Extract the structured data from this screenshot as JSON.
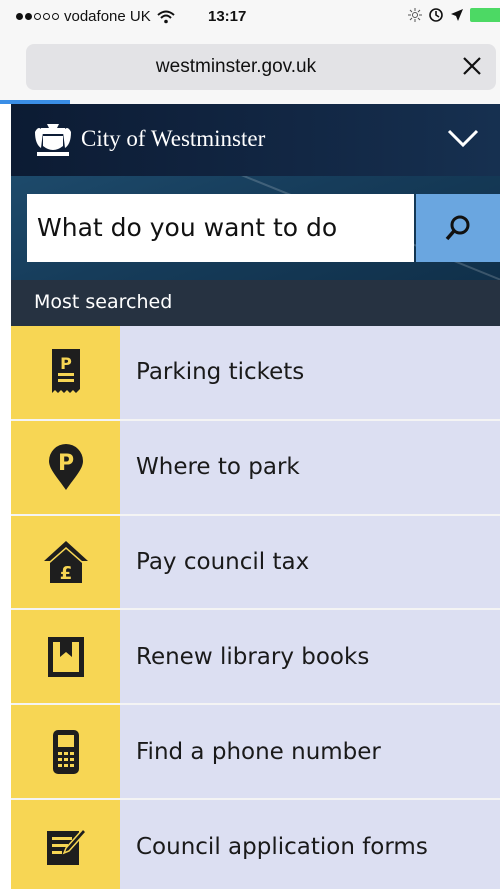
{
  "status_bar": {
    "carrier": "vodafone UK",
    "time": "13:17",
    "signal_bars_filled": 2,
    "signal_bars_total": 5,
    "icons": [
      "wifi-icon",
      "brightness-icon",
      "alarm-icon",
      "location-icon",
      "battery-icon"
    ]
  },
  "browser": {
    "url": "westminster.gov.uk",
    "close_icon": "close-icon"
  },
  "site": {
    "name": "City of Westminster",
    "logo_icon": "westminster-crest-icon",
    "menu_icon": "chevron-down-icon"
  },
  "search": {
    "value": "What do you want to do",
    "button_icon": "search-icon"
  },
  "most_searched": {
    "title": "Most searched",
    "items": [
      {
        "label": "Parking tickets",
        "icon": "parking-ticket-icon"
      },
      {
        "label": "Where to park",
        "icon": "parking-pin-icon"
      },
      {
        "label": "Pay council tax",
        "icon": "house-pound-icon"
      },
      {
        "label": "Renew library books",
        "icon": "book-icon"
      },
      {
        "label": "Find a phone number",
        "icon": "phone-icon"
      },
      {
        "label": "Council application forms",
        "icon": "form-pencil-icon"
      }
    ]
  },
  "colors": {
    "accent_yellow": "#f7d654",
    "item_background": "#dcdff2",
    "header_dark": "#0c1b33",
    "search_button": "#6aa6e0",
    "section_header": "#263241"
  }
}
